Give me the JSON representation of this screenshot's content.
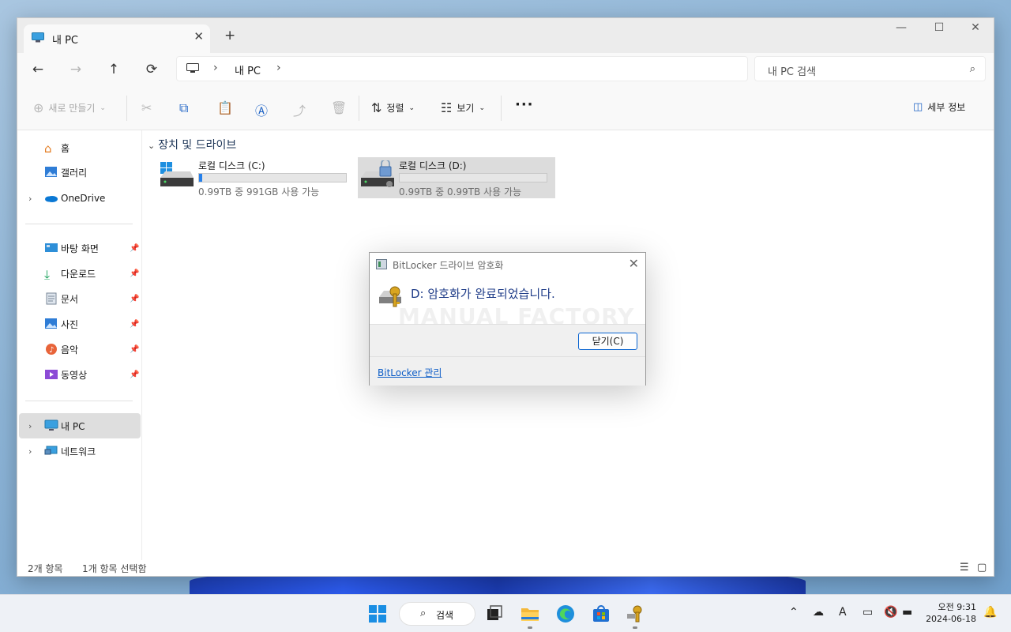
{
  "window": {
    "tab_title": "내 PC",
    "tab_close": "✕",
    "new_tab": "+",
    "minimize": "—",
    "maximize": "☐",
    "close": "✕"
  },
  "nav": {
    "back": "←",
    "forward": "→",
    "up": "↑",
    "refresh": "⟳",
    "address_location": "내 PC",
    "address_sep": "›",
    "search_placeholder": "내 PC 검색"
  },
  "toolbar": {
    "new_label": "새로 만들기",
    "sort_label": "정렬",
    "view_label": "보기",
    "more_label": "···",
    "details_label": "세부 정보",
    "icons": [
      "new-icon",
      "cut-icon",
      "copy-icon",
      "paste-icon",
      "rename-icon",
      "share-icon",
      "delete-icon",
      "sort-icon",
      "view-icon",
      "details-pane-icon"
    ]
  },
  "sidebar": {
    "items": [
      {
        "label": "홈",
        "icon": "home-icon"
      },
      {
        "label": "갤러리",
        "icon": "gallery-icon"
      },
      {
        "label": "OneDrive",
        "icon": "onedrive-icon"
      },
      {
        "label": "바탕 화면",
        "icon": "desktop-icon"
      },
      {
        "label": "다운로드",
        "icon": "download-icon"
      },
      {
        "label": "문서",
        "icon": "documents-icon"
      },
      {
        "label": "사진",
        "icon": "pictures-icon"
      },
      {
        "label": "음악",
        "icon": "music-icon"
      },
      {
        "label": "동영상",
        "icon": "videos-icon"
      },
      {
        "label": "내 PC",
        "icon": "pc-icon"
      },
      {
        "label": "네트워크",
        "icon": "network-icon"
      }
    ]
  },
  "content": {
    "group_title": "장치 및 드라이브",
    "drives": [
      {
        "name": "로컬 디스크 (C:)",
        "free_text": "0.99TB 중 991GB 사용 가능",
        "used_fraction": 0.02,
        "icon": "windows-drive-icon"
      },
      {
        "name": "로컬 디스크 (D:)",
        "free_text": "0.99TB 중 0.99TB 사용 가능",
        "used_fraction": 0.0,
        "icon": "bitlocker-drive-icon"
      }
    ]
  },
  "status": {
    "item_count": "2개 항목",
    "selected": "1개 항목 선택함"
  },
  "dialog": {
    "title": "BitLocker 드라이브 암호화",
    "message": "D: 암호화가 완료되었습니다.",
    "watermark": "MANUAL FACTORY",
    "close_button": "닫기(C)",
    "link": "BitLocker 관리"
  },
  "taskbar": {
    "search_label": "검색",
    "time": "오전 9:31",
    "date": "2024-06-18",
    "apps": [
      "start-icon",
      "task-view-icon",
      "file-explorer-icon",
      "edge-icon",
      "store-icon",
      "bitlocker-icon"
    ]
  },
  "colors": {
    "accent": "#1e63c5",
    "link": "#0b5cc7",
    "dialog_message": "#1f3c88"
  }
}
